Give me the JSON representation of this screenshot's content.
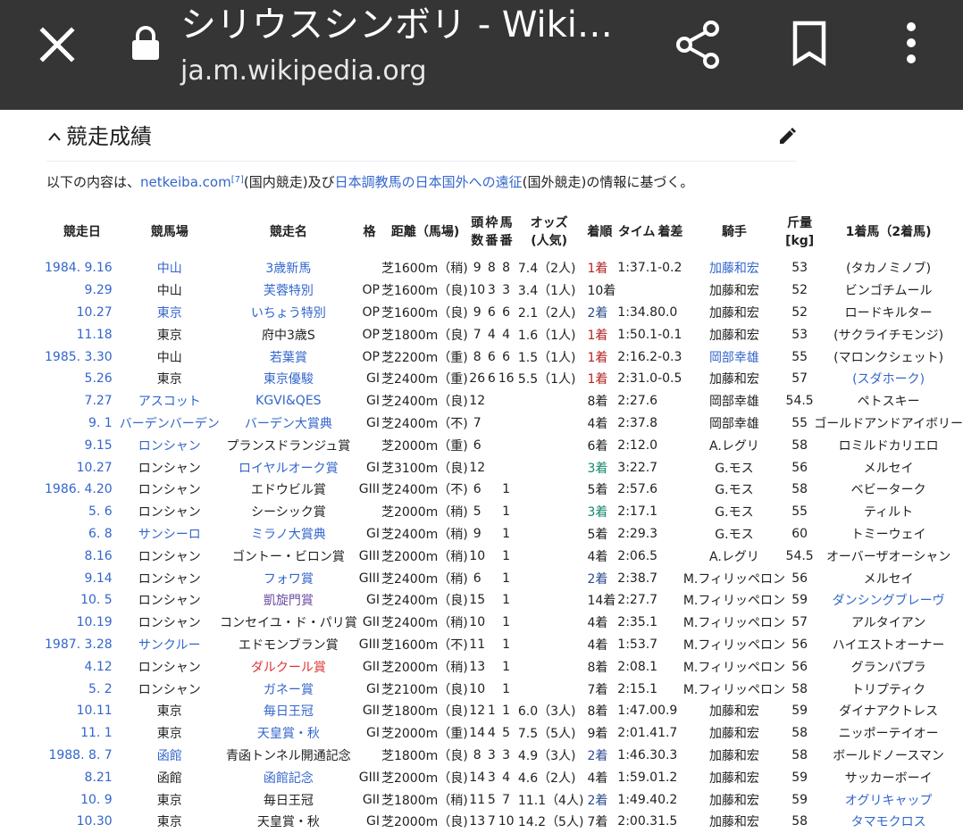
{
  "browser": {
    "title": "シリウスシンボリ - Wiki…",
    "url": "ja.m.wikipedia.org"
  },
  "section": {
    "heading": "競走成績",
    "intro_prefix": "以下の内容は、",
    "intro_link1": "netkeiba.com",
    "intro_ref": "[7]",
    "intro_mid": "(国内競走)及び",
    "intro_link2": "日本調教馬の日本国外への遠征",
    "intro_suffix": "(国外競走)の情報に基づく。"
  },
  "table": {
    "headers": {
      "date": "競走日",
      "course": "競馬場",
      "race": "競走名",
      "grade": "格",
      "dist": "距離（馬場)",
      "field_1": "頭",
      "field_2": "数",
      "gate_1": "枠",
      "gate_2": "番",
      "horse_1": "馬",
      "horse_2": "番",
      "odds_1": "オッズ",
      "odds_2": "(人気)",
      "finish": "着順",
      "time": "タイム",
      "margin": "着差",
      "jockey": "騎手",
      "weight_1": "斤量",
      "weight_2": "[kg]",
      "winner": "1着馬（2着馬)"
    },
    "rows": [
      {
        "date": "1984.  9.16",
        "date_link": true,
        "course": "中山",
        "course_link": "link",
        "race": "3歳新馬",
        "race_link": "link",
        "grade": "",
        "dist": "芝1600m（稍)",
        "field": "9",
        "gate": "8",
        "num": "8",
        "odds": "7.4（2人)",
        "finish": "1着",
        "fin_class": "fin-1",
        "time": "1:37.1",
        "margin": "-0.2",
        "jockey": "加藤和宏",
        "jockey_link": "link",
        "weight": "53",
        "winner": "(タカノミノブ)",
        "winner_link": ""
      },
      {
        "date": "9.29",
        "date_link": true,
        "course": "中山",
        "course_link": "",
        "race": "芙蓉特別",
        "race_link": "link",
        "grade": "OP",
        "dist": "芝1600m（良)",
        "field": "10",
        "gate": "3",
        "num": "3",
        "odds": "3.4（1人)",
        "finish": "10着",
        "fin_class": "",
        "time": "",
        "margin": "",
        "jockey": "加藤和宏",
        "jockey_link": "",
        "weight": "52",
        "winner": "ビンゴチムール",
        "winner_link": ""
      },
      {
        "date": "10.27",
        "date_link": true,
        "course": "東京",
        "course_link": "link",
        "race": "いちょう特別",
        "race_link": "link",
        "grade": "OP",
        "dist": "芝1600m（良)",
        "field": "9",
        "gate": "6",
        "num": "6",
        "odds": "2.1（2人)",
        "finish": "2着",
        "fin_class": "fin-2",
        "time": "1:34.8",
        "margin": "0.0",
        "jockey": "加藤和宏",
        "jockey_link": "",
        "weight": "52",
        "winner": "ロードキルター",
        "winner_link": ""
      },
      {
        "date": "11.18",
        "date_link": true,
        "course": "東京",
        "course_link": "",
        "race": "府中3歳S",
        "race_link": "",
        "grade": "OP",
        "dist": "芝1800m（良)",
        "field": "7",
        "gate": "4",
        "num": "4",
        "odds": "1.6（1人)",
        "finish": "1着",
        "fin_class": "fin-1",
        "time": "1:50.1",
        "margin": "-0.1",
        "jockey": "加藤和宏",
        "jockey_link": "",
        "weight": "53",
        "winner": "(サクライチモンジ)",
        "winner_link": ""
      },
      {
        "date": "1985.  3.30",
        "date_link": true,
        "course": "中山",
        "course_link": "",
        "race": "若葉賞",
        "race_link": "link",
        "grade": "OP",
        "dist": "芝2200m（重)",
        "field": "8",
        "gate": "6",
        "num": "6",
        "odds": "1.5（1人)",
        "finish": "1着",
        "fin_class": "fin-1",
        "time": "2:16.2",
        "margin": "-0.3",
        "jockey": "岡部幸雄",
        "jockey_link": "link",
        "weight": "55",
        "winner": "(マロンクシェット)",
        "winner_link": ""
      },
      {
        "date": "5.26",
        "date_link": true,
        "course": "東京",
        "course_link": "",
        "race": "東京優駿",
        "race_link": "link",
        "grade": "GI",
        "dist": "芝2400m（重)",
        "field": "26",
        "gate": "6",
        "num": "16",
        "odds": "5.5（1人)",
        "finish": "1着",
        "fin_class": "fin-1",
        "time": "2:31.0",
        "margin": "-0.5",
        "jockey": "加藤和宏",
        "jockey_link": "",
        "weight": "57",
        "winner": "(スダホーク)",
        "winner_link": "link"
      },
      {
        "date": "7.27",
        "date_link": true,
        "course": "アスコット",
        "course_link": "link",
        "race": "KGVI&QES",
        "race_link": "link",
        "grade": "GI",
        "dist": "芝2400m（良)",
        "field": "12",
        "gate": "",
        "num": "",
        "odds": "",
        "finish": "8着",
        "fin_class": "",
        "time": "2:27.6",
        "margin": "",
        "jockey": "岡部幸雄",
        "jockey_link": "",
        "weight": "54.5",
        "winner": "ペトスキー",
        "winner_link": ""
      },
      {
        "date": "9.  1",
        "date_link": true,
        "course": "バーデンバーデン",
        "course_link": "link",
        "race": "バーデン大賞典",
        "race_link": "link",
        "grade": "GI",
        "dist": "芝2400m（不)",
        "field": "7",
        "gate": "",
        "num": "",
        "odds": "",
        "finish": "4着",
        "fin_class": "",
        "time": "2:37.8",
        "margin": "",
        "jockey": "岡部幸雄",
        "jockey_link": "",
        "weight": "55",
        "winner": "ゴールドアンドアイボリー",
        "winner_link": ""
      },
      {
        "date": "9.15",
        "date_link": true,
        "course": "ロンシャン",
        "course_link": "link",
        "race": "プランスドランジュ賞",
        "race_link": "",
        "grade": "",
        "dist": "芝2000m（重)",
        "field": "6",
        "gate": "",
        "num": "",
        "odds": "",
        "finish": "6着",
        "fin_class": "",
        "time": "2:12.0",
        "margin": "",
        "jockey": "A.レグリ",
        "jockey_link": "",
        "weight": "58",
        "winner": "ロミルドカリエロ",
        "winner_link": ""
      },
      {
        "date": "10.27",
        "date_link": true,
        "course": "ロンシャン",
        "course_link": "",
        "race": "ロイヤルオーク賞",
        "race_link": "link",
        "grade": "GI",
        "dist": "芝3100m（良)",
        "field": "12",
        "gate": "",
        "num": "",
        "odds": "",
        "finish": "3着",
        "fin_class": "fin-3",
        "time": "3:22.7",
        "margin": "",
        "jockey": "G.モス",
        "jockey_link": "",
        "weight": "56",
        "winner": "メルセイ",
        "winner_link": ""
      },
      {
        "date": "1986.  4.20",
        "date_link": true,
        "course": "ロンシャン",
        "course_link": "",
        "race": "エドウビル賞",
        "race_link": "",
        "grade": "GIII",
        "dist": "芝2400m（不)",
        "field": "6",
        "gate": "",
        "num": "1",
        "odds": "",
        "finish": "5着",
        "fin_class": "",
        "time": "2:57.6",
        "margin": "",
        "jockey": "G.モス",
        "jockey_link": "",
        "weight": "58",
        "winner": "ベビーターク",
        "winner_link": ""
      },
      {
        "date": "5.  6",
        "date_link": true,
        "course": "ロンシャン",
        "course_link": "",
        "race": "シーシック賞",
        "race_link": "",
        "grade": "",
        "dist": "芝2000m（稍)",
        "field": "5",
        "gate": "",
        "num": "1",
        "odds": "",
        "finish": "3着",
        "fin_class": "fin-3",
        "time": "2:17.1",
        "margin": "",
        "jockey": "G.モス",
        "jockey_link": "",
        "weight": "55",
        "winner": "ティルト",
        "winner_link": ""
      },
      {
        "date": "6.  8",
        "date_link": true,
        "course": "サンシーロ",
        "course_link": "link",
        "race": "ミラノ大賞典",
        "race_link": "link",
        "grade": "GI",
        "dist": "芝2400m（稍)",
        "field": "9",
        "gate": "",
        "num": "1",
        "odds": "",
        "finish": "5着",
        "fin_class": "",
        "time": "2:29.3",
        "margin": "",
        "jockey": "G.モス",
        "jockey_link": "",
        "weight": "60",
        "winner": "トミーウェイ",
        "winner_link": ""
      },
      {
        "date": "8.16",
        "date_link": true,
        "course": "ロンシャン",
        "course_link": "",
        "race": "ゴントー・ビロン賞",
        "race_link": "",
        "grade": "GIII",
        "dist": "芝2000m（稍)",
        "field": "10",
        "gate": "",
        "num": "1",
        "odds": "",
        "finish": "4着",
        "fin_class": "",
        "time": "2:06.5",
        "margin": "",
        "jockey": "A.レグリ",
        "jockey_link": "",
        "weight": "54.5",
        "winner": "オーバーザオーシャン",
        "winner_link": ""
      },
      {
        "date": "9.14",
        "date_link": true,
        "course": "ロンシャン",
        "course_link": "",
        "race": "フォワ賞",
        "race_link": "link",
        "grade": "GIII",
        "dist": "芝2400m（稍)",
        "field": "6",
        "gate": "",
        "num": "1",
        "odds": "",
        "finish": "2着",
        "fin_class": "fin-2",
        "time": "2:38.7",
        "margin": "",
        "jockey": "M.フィリッペロン",
        "jockey_link": "",
        "weight": "56",
        "winner": "メルセイ",
        "winner_link": ""
      },
      {
        "date": "10.  5",
        "date_link": true,
        "course": "ロンシャン",
        "course_link": "",
        "race": "凱旋門賞",
        "race_link": "link-visited",
        "grade": "GI",
        "dist": "芝2400m（良)",
        "field": "15",
        "gate": "",
        "num": "1",
        "odds": "",
        "finish": "14着",
        "fin_class": "",
        "time": "2:27.7",
        "margin": "",
        "jockey": "M.フィリッペロン",
        "jockey_link": "",
        "weight": "59",
        "winner": "ダンシングブレーヴ",
        "winner_link": "link"
      },
      {
        "date": "10.19",
        "date_link": true,
        "course": "ロンシャン",
        "course_link": "",
        "race": "コンセイユ・ド・パリ賞",
        "race_link": "",
        "grade": "GII",
        "dist": "芝2400m（稍)",
        "field": "10",
        "gate": "",
        "num": "1",
        "odds": "",
        "finish": "4着",
        "fin_class": "",
        "time": "2:35.1",
        "margin": "",
        "jockey": "M.フィリッペロン",
        "jockey_link": "",
        "weight": "57",
        "winner": "アルタイアン",
        "winner_link": ""
      },
      {
        "date": "1987.  3.28",
        "date_link": true,
        "course": "サンクルー",
        "course_link": "link",
        "race": "エドモンブラン賞",
        "race_link": "",
        "grade": "GIII",
        "dist": "芝1600m（不)",
        "field": "11",
        "gate": "",
        "num": "1",
        "odds": "",
        "finish": "4着",
        "fin_class": "",
        "time": "1:53.7",
        "margin": "",
        "jockey": "M.フィリッペロン",
        "jockey_link": "",
        "weight": "56",
        "winner": "ハイエストオーナー",
        "winner_link": ""
      },
      {
        "date": "4.12",
        "date_link": true,
        "course": "ロンシャン",
        "course_link": "",
        "race": "ダルクール賞",
        "race_link": "link-red",
        "grade": "GII",
        "dist": "芝2000m（稍)",
        "field": "13",
        "gate": "",
        "num": "1",
        "odds": "",
        "finish": "8着",
        "fin_class": "",
        "time": "2:08.1",
        "margin": "",
        "jockey": "M.フィリッペロン",
        "jockey_link": "",
        "weight": "56",
        "winner": "グランパプラ",
        "winner_link": ""
      },
      {
        "date": "5.  2",
        "date_link": true,
        "course": "ロンシャン",
        "course_link": "",
        "race": "ガネー賞",
        "race_link": "link",
        "grade": "GI",
        "dist": "芝2100m（良)",
        "field": "10",
        "gate": "",
        "num": "1",
        "odds": "",
        "finish": "7着",
        "fin_class": "",
        "time": "2:15.1",
        "margin": "",
        "jockey": "M.フィリッペロン",
        "jockey_link": "",
        "weight": "58",
        "winner": "トリプティク",
        "winner_link": ""
      },
      {
        "date": "10.11",
        "date_link": true,
        "course": "東京",
        "course_link": "",
        "race": "毎日王冠",
        "race_link": "link",
        "grade": "GII",
        "dist": "芝1800m（良)",
        "field": "12",
        "gate": "1",
        "num": "1",
        "odds": "6.0（3人)",
        "finish": "8着",
        "fin_class": "",
        "time": "1:47.0",
        "margin": "0.9",
        "jockey": "加藤和宏",
        "jockey_link": "",
        "weight": "59",
        "winner": "ダイナアクトレス",
        "winner_link": ""
      },
      {
        "date": "11.  1",
        "date_link": true,
        "course": "東京",
        "course_link": "",
        "race": "天皇賞・秋",
        "race_link": "link",
        "grade": "GI",
        "dist": "芝2000m（重)",
        "field": "14",
        "gate": "4",
        "num": "5",
        "odds": "7.5（5人)",
        "finish": "9着",
        "fin_class": "",
        "time": "2:01.4",
        "margin": "1.7",
        "jockey": "加藤和宏",
        "jockey_link": "",
        "weight": "58",
        "winner": "ニッポーテイオー",
        "winner_link": ""
      },
      {
        "date": "1988.  8.  7",
        "date_link": true,
        "course": "函館",
        "course_link": "link",
        "race": "青函トンネル開通記念",
        "race_link": "",
        "grade": "",
        "dist": "芝1800m（良)",
        "field": "8",
        "gate": "3",
        "num": "3",
        "odds": "4.9（3人)",
        "finish": "2着",
        "fin_class": "fin-2",
        "time": "1:46.3",
        "margin": "0.3",
        "jockey": "加藤和宏",
        "jockey_link": "",
        "weight": "58",
        "winner": "ボールドノースマン",
        "winner_link": ""
      },
      {
        "date": "8.21",
        "date_link": true,
        "course": "函館",
        "course_link": "",
        "race": "函館記念",
        "race_link": "link",
        "grade": "GIII",
        "dist": "芝2000m（良)",
        "field": "14",
        "gate": "3",
        "num": "4",
        "odds": "4.6（2人)",
        "finish": "4着",
        "fin_class": "",
        "time": "1:59.0",
        "margin": "1.2",
        "jockey": "加藤和宏",
        "jockey_link": "",
        "weight": "59",
        "winner": "サッカーボーイ",
        "winner_link": ""
      },
      {
        "date": "10.  9",
        "date_link": true,
        "course": "東京",
        "course_link": "",
        "race": "毎日王冠",
        "race_link": "",
        "grade": "GII",
        "dist": "芝1800m（稍)",
        "field": "11",
        "gate": "5",
        "num": "7",
        "odds": "11.1（4人)",
        "finish": "2着",
        "fin_class": "fin-2",
        "time": "1:49.4",
        "margin": "0.2",
        "jockey": "加藤和宏",
        "jockey_link": "",
        "weight": "59",
        "winner": "オグリキャップ",
        "winner_link": "link"
      },
      {
        "date": "10.30",
        "date_link": true,
        "course": "東京",
        "course_link": "",
        "race": "天皇賞・秋",
        "race_link": "",
        "grade": "GI",
        "dist": "芝2000m（良)",
        "field": "13",
        "gate": "7",
        "num": "10",
        "odds": "14.2（5人)",
        "finish": "7着",
        "fin_class": "",
        "time": "2:00.3",
        "margin": "1.5",
        "jockey": "加藤和宏",
        "jockey_link": "",
        "weight": "58",
        "winner": "タマモクロス",
        "winner_link": "link"
      }
    ]
  }
}
